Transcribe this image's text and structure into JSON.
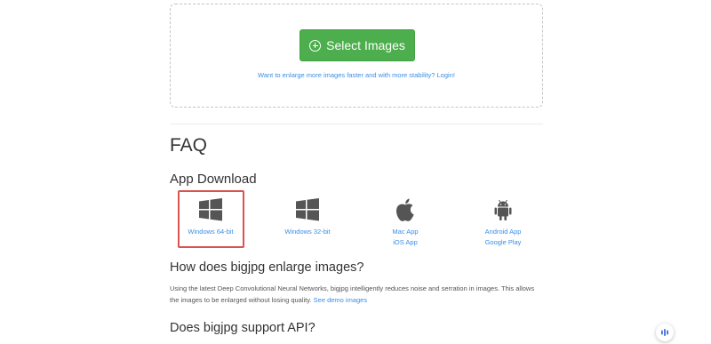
{
  "upload": {
    "select_label": "Select Images",
    "login_text": "Want to enlarge more images faster and with more stability? Login!"
  },
  "faq": {
    "title": "FAQ",
    "app_download_title": "App Download",
    "apps": {
      "win64": "Windows 64-bit",
      "win32": "Windows 32-bit",
      "mac": "Mac App",
      "ios": "iOS App",
      "android": "Android App",
      "google_play": "Google Play"
    },
    "q1": {
      "title": "How does bigjpg enlarge images?",
      "text": "Using the latest Deep Convolutional Neural Networks, bigjpg intelligently reduces noise and serration in images. This allows the images to be enlarged without losing quality.",
      "link": "See demo images"
    },
    "q2": {
      "title": "Does bigjpg support API?"
    }
  },
  "colors": {
    "button_green": "#4cae4c",
    "link_blue": "#3a8ee6",
    "highlight_red": "#d9534f"
  }
}
